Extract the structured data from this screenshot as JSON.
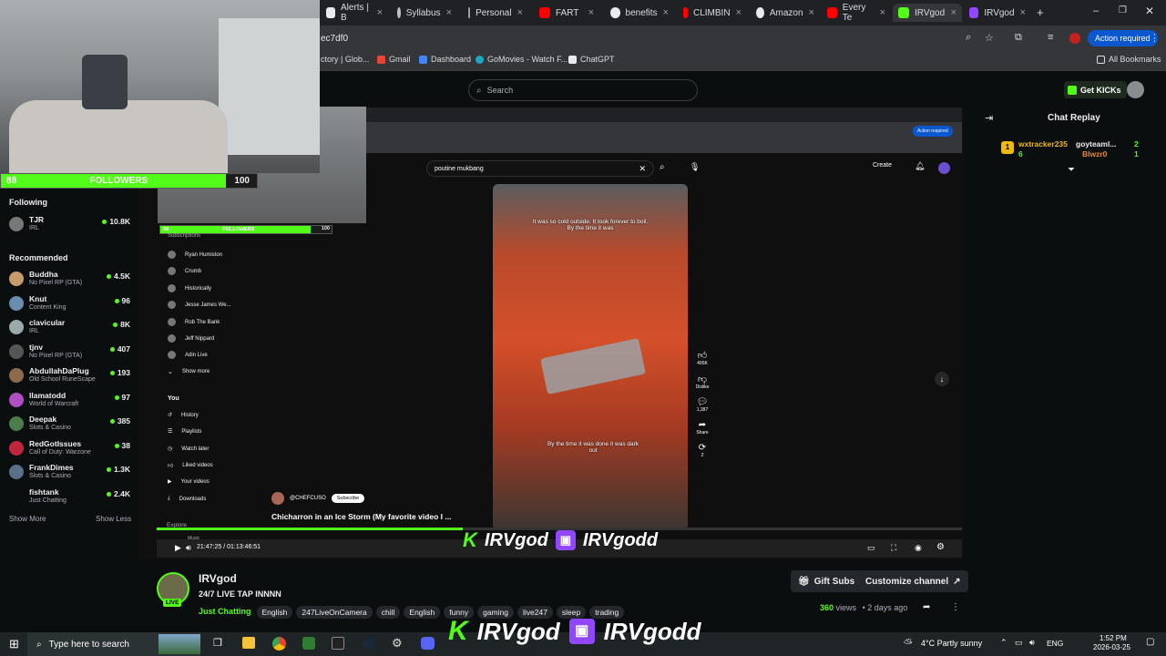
{
  "browser": {
    "tabs": [
      {
        "label": "Alerts | B",
        "color": "#e8eaed"
      },
      {
        "label": "Syllabus",
        "color": "#e8eaed"
      },
      {
        "label": "Personal",
        "color": "#bdc1c6"
      },
      {
        "label": "FART",
        "color": "#ff0000"
      },
      {
        "label": "benefits",
        "color": "#e8eaed"
      },
      {
        "label": "CLIMBIN",
        "color": "#ff0000"
      },
      {
        "label": "Amazon",
        "color": "#e8eaed"
      },
      {
        "label": "Every Te",
        "color": "#ff0000"
      },
      {
        "label": "IRVgod",
        "color": "#53fc18"
      },
      {
        "label": "IRVgod",
        "color": "#9146ff"
      }
    ],
    "new_tab": "+",
    "address": "ec7df0",
    "action_required": "Action required",
    "bookmarks": [
      "ctory | Glob...",
      "Gmail",
      "Dashboard",
      "GoMovies - Watch F...",
      "ChatGPT"
    ],
    "all_bookmarks": "All Bookmarks"
  },
  "kick": {
    "search_placeholder": "Search",
    "get_kicks": "Get KICKs",
    "followers_count": "88",
    "followers_label": "FOLLOWERS",
    "followers_goal": "100",
    "sidebar": {
      "following_label": "Following",
      "following": [
        {
          "name": "TJR",
          "category": "IRL",
          "viewers": "10.8K",
          "color": "#777"
        }
      ],
      "recommended_label": "Recommended",
      "recommended": [
        {
          "name": "Buddha",
          "category": "No Pixel RP (GTA)",
          "viewers": "4.5K",
          "color": "#c89b6d"
        },
        {
          "name": "Knut",
          "category": "Content King",
          "viewers": "96",
          "color": "#6a8caf"
        },
        {
          "name": "clavicular",
          "category": "IRL",
          "viewers": "8K",
          "color": "#9aa"
        },
        {
          "name": "tjnv",
          "category": "No Pixel RP (GTA)",
          "viewers": "407",
          "color": "#555"
        },
        {
          "name": "AbdullahDaPlug",
          "category": "Old School RuneScape",
          "viewers": "193",
          "color": "#8b6b4a"
        },
        {
          "name": "llamatodd",
          "category": "World of Warcraft",
          "viewers": "97",
          "color": "#b04fc4"
        },
        {
          "name": "Deepak",
          "category": "Slots & Casino",
          "viewers": "385",
          "color": "#4a7d4a"
        },
        {
          "name": "RedGotIssues",
          "category": "Call of Duty: Warzone",
          "viewers": "38",
          "color": "#c0263b"
        },
        {
          "name": "FrankDimes",
          "category": "Slots & Casino",
          "viewers": "1.3K",
          "color": "#5a6f8a"
        },
        {
          "name": "fishtank",
          "category": "Just Chatting",
          "viewers": "2.4K",
          "color": "#0b0e0f"
        }
      ],
      "show_more": "Show More",
      "show_less": "Show Less"
    },
    "chat": {
      "title": "Chat Replay",
      "messages": [
        {
          "user": "wxtracker235",
          "value": "6",
          "user2": "goyteaml...",
          "value2": "2"
        },
        {
          "user": "Blwzr0",
          "value": "1"
        }
      ]
    },
    "channel": {
      "name": "IRVgod",
      "title": "24/7 LIVE TAP INNNN",
      "live": "LIVE",
      "category": "Just Chatting",
      "tags": [
        "English",
        "247LiveOnCamera",
        "chill",
        "English",
        "funny",
        "gaming",
        "live247",
        "sleep",
        "trading"
      ],
      "gift_subs": "Gift Subs",
      "customize": "Customize channel",
      "views": "360",
      "views_label": "views",
      "ago": "2 days ago"
    },
    "overlay": {
      "kick_name": "IRVgod",
      "twitch_name": "IRVgodd",
      "time": "21:47:25 / 01:13:46:51"
    }
  },
  "stream_content": {
    "inner_search": "poutine mukbang",
    "create": "Create",
    "caption_top": "It was so cold outside. It took forever to boil. By the time it was",
    "caption_bottom": "By the time it was done it was dark out",
    "likes": "495K",
    "dislike": "Dislike",
    "comments": "1,387",
    "share": "Share",
    "remix": "2",
    "channel": "@CHEFCUSO",
    "subscribe": "Subscribe",
    "video_title": "Chicharron in an Ice Storm (My favorite video I ...",
    "yt_sidebar": [
      "Subscriptions",
      "Ryan Humiston",
      "Crumb",
      "Historically",
      "Jesse James We...",
      "Rob The Bank",
      "Jeff Nippard",
      "Adin Live",
      "Show more",
      "You",
      "History",
      "Playlists",
      "Watch later",
      "Liked videos",
      "Your videos",
      "Downloads",
      "Explore",
      "Music"
    ],
    "inner_follow_count": "88",
    "inner_followers": "FOLLOWERS",
    "inner_goal": "100"
  },
  "taskbar": {
    "search": "Type here to search",
    "weather": "4°C  Partly sunny",
    "lang": "ENG",
    "time": "1:52 PM",
    "date": "2026-03-25"
  }
}
